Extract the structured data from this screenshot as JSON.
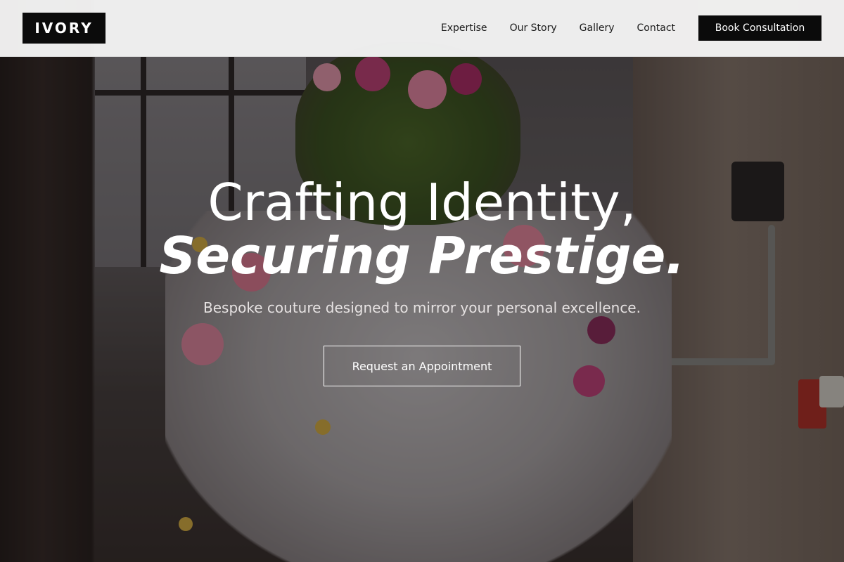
{
  "brand": {
    "logo_text": "IVORY"
  },
  "nav": {
    "links": [
      {
        "label": "Expertise"
      },
      {
        "label": "Our Story"
      },
      {
        "label": "Gallery"
      },
      {
        "label": "Contact"
      }
    ],
    "cta_label": "Book Consultation"
  },
  "hero": {
    "title_line1": "Crafting Identity,",
    "title_line2": "Securing Prestige.",
    "subtitle": "Bespoke couture designed to mirror your personal excellence.",
    "cta_label": "Request an Appointment",
    "background_image": "floral-dress-on-mannequin-in-industrial-room"
  },
  "colors": {
    "nav_bg": "#f5f5f5",
    "logo_bg": "#0b0b0b",
    "cta_bg": "#0b0b0b",
    "hero_text": "#ffffff"
  }
}
